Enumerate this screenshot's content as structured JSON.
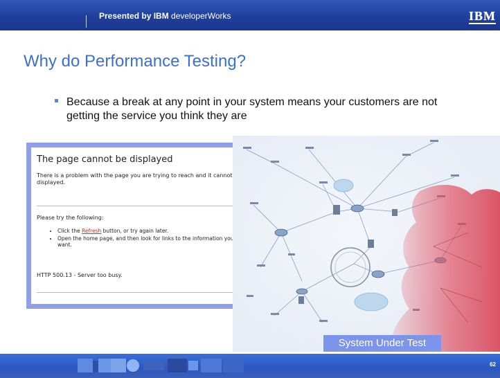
{
  "header": {
    "presented_bold": "Presented by IBM",
    "presented_rest": " developerWorks",
    "logo_text": "IBM"
  },
  "slide": {
    "title": "Why do Performance Testing?",
    "bullet": "Because a break at any point in your system means your customers are not getting the service you think they are"
  },
  "error_page": {
    "heading": "The page cannot be displayed",
    "paragraph": "There is a problem with the page you are trying to reach and it cannot be displayed.",
    "try_label": "Please try the following:",
    "item1_before": "Click the ",
    "item1_link": "Refresh",
    "item1_after": " button, or try again later.",
    "item2": "Open the home page, and then look for links to the information you want.",
    "http_status": "HTTP 500.13 - Server too busy."
  },
  "diagram": {
    "label": "System Under Test"
  },
  "footer": {
    "page_number": "62"
  },
  "colors": {
    "header_blue": "#1f3f9c",
    "title_blue": "#3d6fd0",
    "label_blue": "#7c95ea",
    "error_frame": "#8f9fe8",
    "highlight_red": "#e0485a"
  }
}
